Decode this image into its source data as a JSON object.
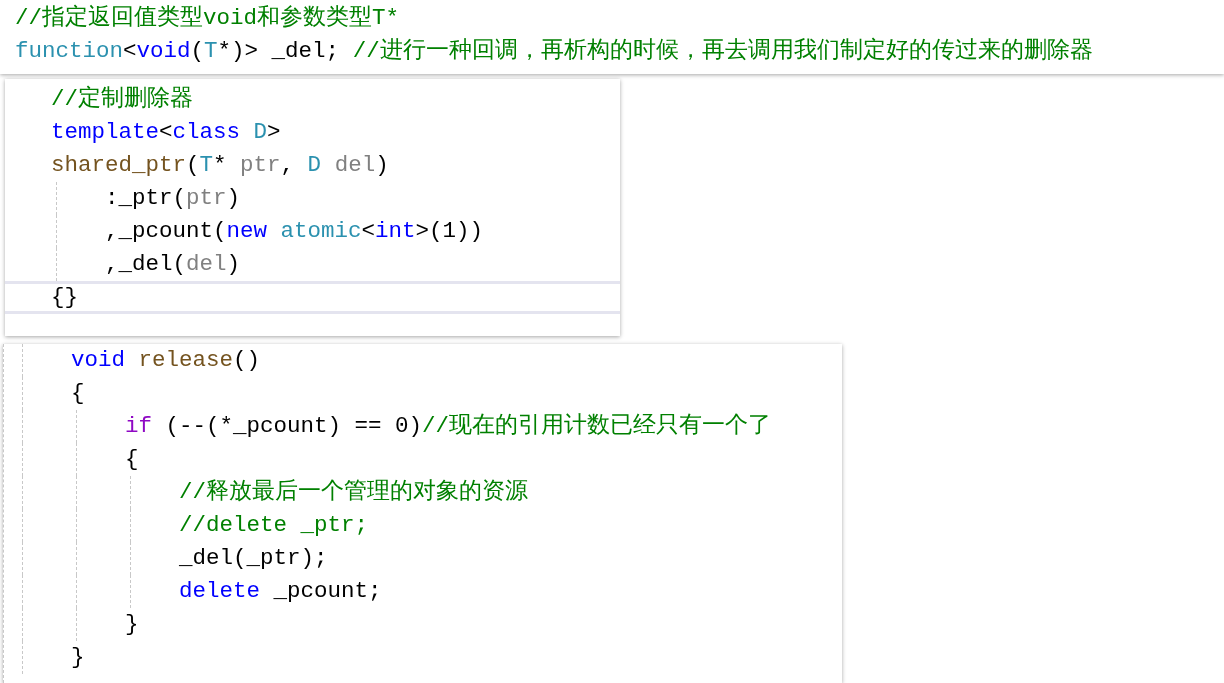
{
  "snippets": [
    {
      "lines": [
        {
          "tokens": [
            {
              "text": "//指定返回值类型void和参数类型T*",
              "kind": "comment"
            }
          ]
        },
        {
          "tokens": [
            {
              "text": "function",
              "kind": "type"
            },
            {
              "text": "<",
              "kind": "plain"
            },
            {
              "text": "void",
              "kind": "keyword"
            },
            {
              "text": "(",
              "kind": "plain"
            },
            {
              "text": "T",
              "kind": "type"
            },
            {
              "text": "*)> _del; ",
              "kind": "plain"
            },
            {
              "text": "//进行一种回调，再析构的时候，再去调用我们制定好的传过来的删除器",
              "kind": "comment"
            }
          ]
        }
      ]
    },
    {
      "lines": [
        {
          "current": false,
          "tokens": [
            {
              "text": "//定制删除器",
              "kind": "comment"
            }
          ]
        },
        {
          "current": false,
          "tokens": [
            {
              "text": "template",
              "kind": "keyword"
            },
            {
              "text": "<",
              "kind": "plain"
            },
            {
              "text": "class",
              "kind": "keyword"
            },
            {
              "text": " D",
              "kind": "type"
            },
            {
              "text": ">",
              "kind": "plain"
            }
          ]
        },
        {
          "current": false,
          "tokens": [
            {
              "text": "shared_ptr",
              "kind": "func"
            },
            {
              "text": "(",
              "kind": "plain"
            },
            {
              "text": "T",
              "kind": "type"
            },
            {
              "text": "* ",
              "kind": "plain"
            },
            {
              "text": "ptr",
              "kind": "param"
            },
            {
              "text": ", ",
              "kind": "plain"
            },
            {
              "text": "D",
              "kind": "type"
            },
            {
              "text": " del",
              "kind": "param"
            },
            {
              "text": ")",
              "kind": "plain"
            }
          ]
        },
        {
          "current": false,
          "tokens": [
            {
              "text": "    :_ptr(",
              "kind": "plain"
            },
            {
              "text": "ptr",
              "kind": "param"
            },
            {
              "text": ")",
              "kind": "plain"
            }
          ]
        },
        {
          "current": false,
          "tokens": [
            {
              "text": "    ,_pcount(",
              "kind": "plain"
            },
            {
              "text": "new",
              "kind": "keyword"
            },
            {
              "text": " atomic",
              "kind": "type"
            },
            {
              "text": "<",
              "kind": "plain"
            },
            {
              "text": "int",
              "kind": "keyword"
            },
            {
              "text": ">(1))",
              "kind": "plain"
            }
          ]
        },
        {
          "current": false,
          "tokens": [
            {
              "text": "    ,_del(",
              "kind": "plain"
            },
            {
              "text": "del",
              "kind": "param"
            },
            {
              "text": ")",
              "kind": "plain"
            }
          ]
        },
        {
          "current": true,
          "tokens": [
            {
              "text": "{}",
              "kind": "plain"
            }
          ]
        }
      ]
    },
    {
      "lines": [
        {
          "tokens": [
            {
              "text": "    void",
              "kind": "keyword"
            },
            {
              "text": " release",
              "kind": "func"
            },
            {
              "text": "()",
              "kind": "plain"
            }
          ]
        },
        {
          "tokens": [
            {
              "text": "    {",
              "kind": "plain"
            }
          ]
        },
        {
          "tokens": [
            {
              "text": "        if",
              "kind": "control"
            },
            {
              "text": " (--(*_pcount) == 0)",
              "kind": "plain"
            },
            {
              "text": "//现在的引用计数已经只有一个了",
              "kind": "comment"
            }
          ]
        },
        {
          "tokens": [
            {
              "text": "        {",
              "kind": "plain"
            }
          ]
        },
        {
          "tokens": [
            {
              "text": "            //释放最后一个管理的对象的资源",
              "kind": "comment"
            }
          ]
        },
        {
          "tokens": [
            {
              "text": "            //delete _ptr;",
              "kind": "comment"
            }
          ]
        },
        {
          "tokens": [
            {
              "text": "            _del(_ptr);",
              "kind": "plain"
            }
          ]
        },
        {
          "tokens": [
            {
              "text": "            delete",
              "kind": "keyword"
            },
            {
              "text": " _pcount;",
              "kind": "plain"
            }
          ]
        },
        {
          "tokens": [
            {
              "text": "        }",
              "kind": "plain"
            }
          ]
        },
        {
          "tokens": [
            {
              "text": "    }",
              "kind": "plain"
            }
          ]
        }
      ]
    }
  ]
}
